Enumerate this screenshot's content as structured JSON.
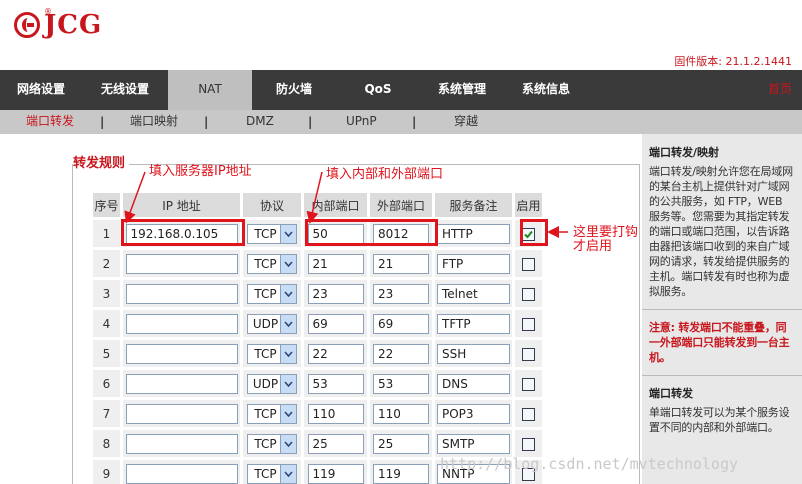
{
  "brand": {
    "logo_text": "JCG",
    "logo_reg": "®"
  },
  "firmware_label": "固件版本: 21.1.2.1441",
  "nav": {
    "items": [
      "网络设置",
      "无线设置",
      "NAT",
      "防火墙",
      "QoS",
      "系统管理",
      "系统信息"
    ],
    "active": "NAT",
    "home": "首页"
  },
  "subnav": {
    "items": [
      "端口转发",
      "端口映射",
      "DMZ",
      "UPnP",
      "穿越"
    ],
    "separator": "|",
    "active": "端口转发"
  },
  "rules": {
    "title": "转发规则",
    "headers": [
      "序号",
      "IP 地址",
      "协议",
      "内部端口",
      "外部端口",
      "服务备注",
      "启用"
    ],
    "rows": [
      {
        "no": "1",
        "ip": "192.168.0.105",
        "proto": "TCP",
        "in": "50",
        "ex": "8012",
        "note": "HTTP",
        "enabled": true
      },
      {
        "no": "2",
        "ip": "",
        "proto": "TCP",
        "in": "21",
        "ex": "21",
        "note": "FTP",
        "enabled": false
      },
      {
        "no": "3",
        "ip": "",
        "proto": "TCP",
        "in": "23",
        "ex": "23",
        "note": "Telnet",
        "enabled": false
      },
      {
        "no": "4",
        "ip": "",
        "proto": "UDP",
        "in": "69",
        "ex": "69",
        "note": "TFTP",
        "enabled": false
      },
      {
        "no": "5",
        "ip": "",
        "proto": "TCP",
        "in": "22",
        "ex": "22",
        "note": "SSH",
        "enabled": false
      },
      {
        "no": "6",
        "ip": "",
        "proto": "UDP",
        "in": "53",
        "ex": "53",
        "note": "DNS",
        "enabled": false
      },
      {
        "no": "7",
        "ip": "",
        "proto": "TCP",
        "in": "110",
        "ex": "110",
        "note": "POP3",
        "enabled": false
      },
      {
        "no": "8",
        "ip": "",
        "proto": "TCP",
        "in": "25",
        "ex": "25",
        "note": "SMTP",
        "enabled": false
      },
      {
        "no": "9",
        "ip": "",
        "proto": "TCP",
        "in": "119",
        "ex": "119",
        "note": "NNTP",
        "enabled": false
      }
    ]
  },
  "annotations": {
    "server_ip": "填入服务器IP地址",
    "ports": "填入内部和外部端口",
    "enable_line1": "这里要打钩",
    "enable_line2": "才启用"
  },
  "sidebar": {
    "title1": "端口转发/映射",
    "text1": "端口转发/映射允许您在局域网的某台主机上提供针对广域网的公共服务，如 FTP，WEB 服务等。您需要为其指定转发的端口或端口范围，以告诉路由器把该端口收到的来自广域网的请求，转发给提供服务的主机。端口转发有时也称为虚拟服务。",
    "warn": "注意: 转发端口不能重叠，同一外部端口只能转发到一台主机。",
    "title2": "端口转发",
    "text2": "单端口转发可以为某个服务设置不同的内部和外部端口。"
  },
  "watermark": "http://blog.csdn.net/mvtechnology",
  "colors": {
    "accent": "#c8161d",
    "annotation": "#e0141c",
    "nav_bg": "#3a3a3a",
    "subnav_bg": "#c8c8c8"
  }
}
